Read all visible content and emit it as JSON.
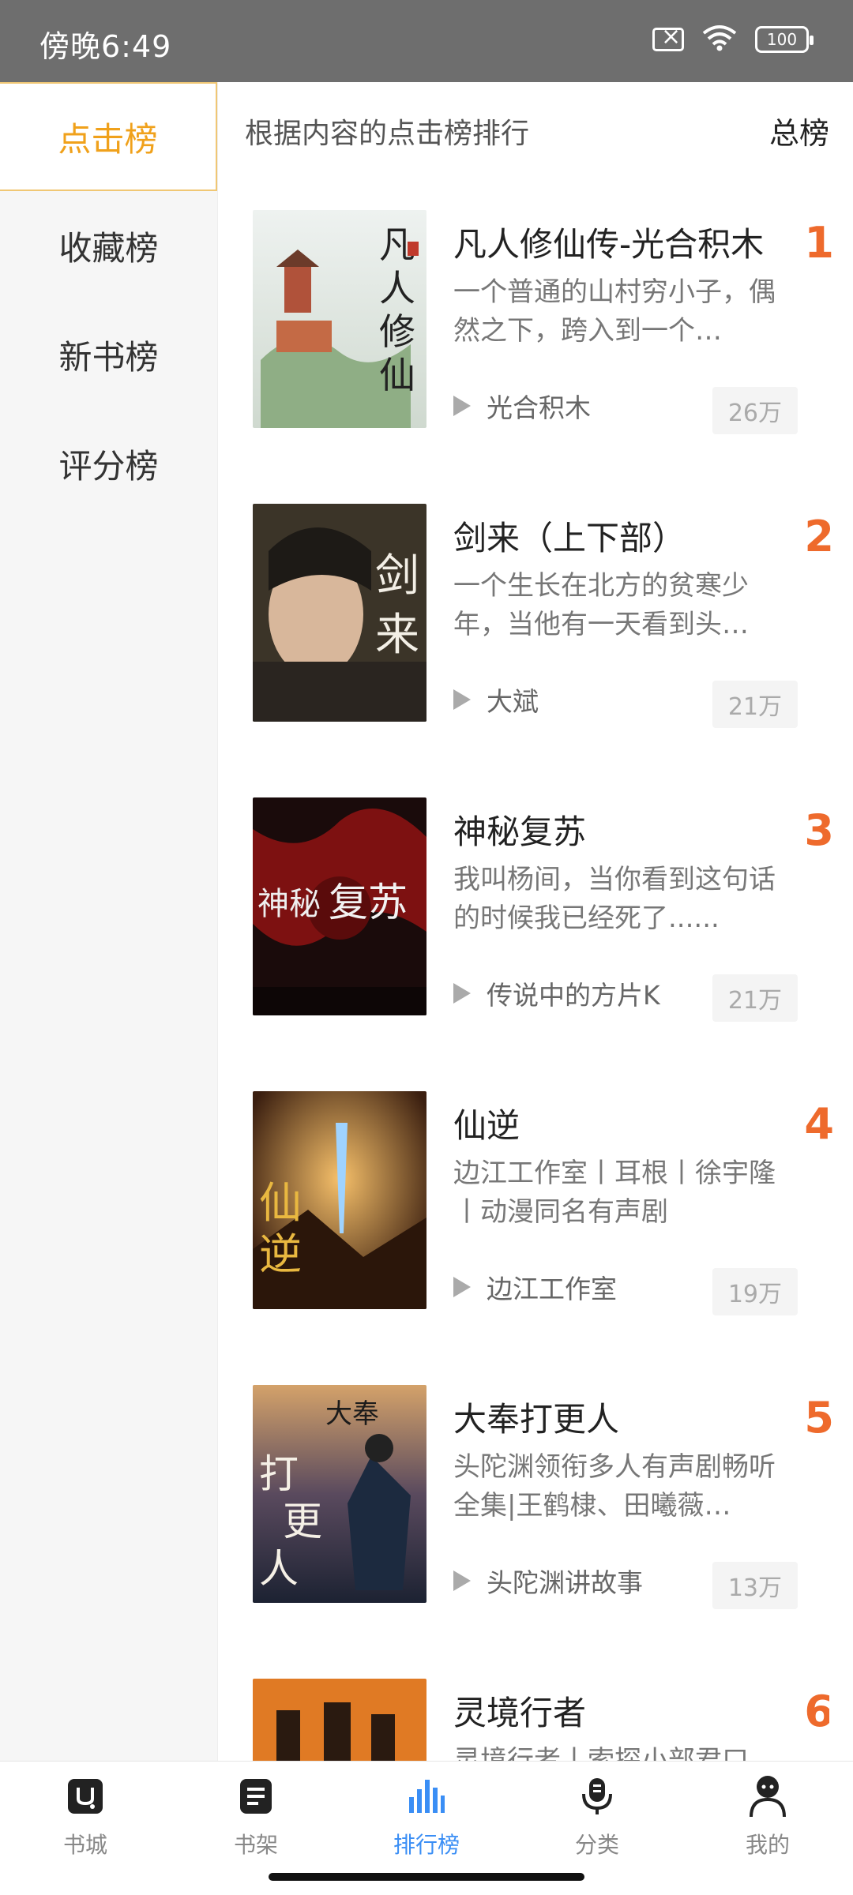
{
  "status_bar": {
    "time": "傍晚6:49",
    "battery": "100"
  },
  "sidebar": {
    "items": [
      {
        "label": "点击榜",
        "active": true
      },
      {
        "label": "收藏榜",
        "active": false
      },
      {
        "label": "新书榜",
        "active": false
      },
      {
        "label": "评分榜",
        "active": false
      }
    ]
  },
  "header": {
    "description": "根据内容的点击榜排行",
    "scope": "总榜"
  },
  "books": [
    {
      "rank": "1",
      "title": "凡人修仙传-光合积木",
      "desc": "一个普通的山村穷小子，偶然之下，跨入到一个…",
      "author": "光合积木",
      "count": "26万"
    },
    {
      "rank": "2",
      "title": "剑来（上下部）",
      "desc": "一个生长在北方的贫寒少年，当他有一天看到头…",
      "author": "大斌",
      "count": "21万"
    },
    {
      "rank": "3",
      "title": "神秘复苏",
      "desc": "我叫杨间，当你看到这句话的时候我已经死了......",
      "author": "传说中的方片K",
      "count": "21万"
    },
    {
      "rank": "4",
      "title": "仙逆",
      "desc": "边江工作室丨耳根丨徐宇隆丨动漫同名有声剧",
      "author": "边江工作室",
      "count": "19万"
    },
    {
      "rank": "5",
      "title": "大奉打更人",
      "desc": "头陀渊领衔多人有声剧畅听全集|王鹤棣、田曦薇…",
      "author": "头陀渊讲故事",
      "count": "13万"
    },
    {
      "rank": "6",
      "title": "灵境行者",
      "desc": "灵境行者丨索探小部君口",
      "author": "",
      "count": ""
    }
  ],
  "bottom_nav": {
    "items": [
      {
        "label": "书城",
        "icon": "bookstore-icon"
      },
      {
        "label": "书架",
        "icon": "bookshelf-icon"
      },
      {
        "label": "排行榜",
        "icon": "ranking-icon",
        "active": true
      },
      {
        "label": "分类",
        "icon": "microphone-icon"
      },
      {
        "label": "我的",
        "icon": "profile-icon"
      }
    ]
  },
  "colors": {
    "accent": "#f0a11b",
    "rank": "#ee6a2c",
    "nav_active": "#3a8ef5"
  }
}
